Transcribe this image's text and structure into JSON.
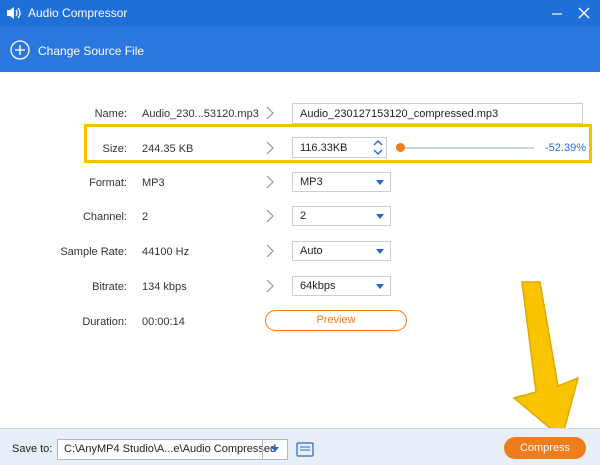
{
  "window": {
    "title": "Audio Compressor"
  },
  "toolbar": {
    "change_source_label": "Change Source File"
  },
  "labels": {
    "name": "Name:",
    "size": "Size:",
    "format": "Format:",
    "channel": "Channel:",
    "sample_rate": "Sample Rate:",
    "bitrate": "Bitrate:",
    "duration": "Duration:"
  },
  "source": {
    "name": "Audio_230...53120.mp3",
    "size": "244.35 KB",
    "format": "MP3",
    "channel": "2",
    "sample_rate": "44100 Hz",
    "bitrate": "134 kbps",
    "duration": "00:00:14"
  },
  "output": {
    "name": "Audio_230127153120_compressed.mp3",
    "size": "116.33KB",
    "format": "MP3",
    "channel": "2",
    "sample_rate": "Auto",
    "bitrate": "64kbps",
    "size_change": "-52.39%",
    "slider_fraction": 0.0
  },
  "buttons": {
    "preview": "Preview",
    "compress": "Compress"
  },
  "bottom": {
    "save_to_label": "Save to:",
    "save_path": "C:\\AnyMP4 Studio\\A...e\\Audio Compressed"
  },
  "colors": {
    "titlebar": "#1f6fd8",
    "accent": "#f07c1c",
    "highlight": "#f5c200"
  }
}
